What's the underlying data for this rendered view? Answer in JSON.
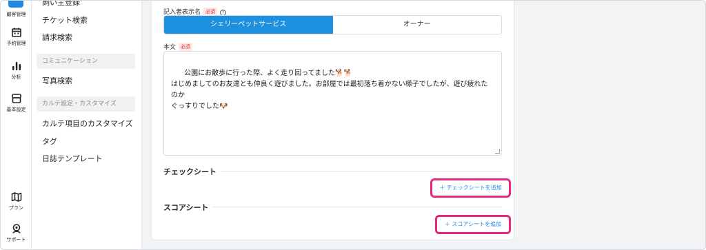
{
  "rail": {
    "items": [
      {
        "label": "顧客管理",
        "icon": "customer-icon"
      },
      {
        "label": "予約管理",
        "icon": "calendar-icon"
      },
      {
        "label": "分析",
        "icon": "chart-icon"
      },
      {
        "label": "基本設定",
        "icon": "settings-box-icon"
      },
      {
        "label": "プラン",
        "icon": "map-icon"
      },
      {
        "label": "サポート",
        "icon": "support-icon"
      }
    ]
  },
  "subnav": {
    "items_top": [
      "飼い主登録",
      "チケット検索",
      "請求検索"
    ],
    "section_communication": "コミュニケーション",
    "items_comm": [
      "写真検索"
    ],
    "section_custom": "カルテ設定・カスタマイズ",
    "items_custom": [
      "カルテ項目のカスタマイズ",
      "タグ",
      "日誌テンプレート"
    ]
  },
  "form": {
    "author_label": "記入者表示名",
    "required": "必須",
    "help": "?",
    "author_options": [
      "シェリーペットサービス",
      "オーナー"
    ],
    "body_label": "本文",
    "body_text": "公園にお散歩に行った際、よく走り回ってました🐕🐕\nはじめましてのお友達とも仲良く遊びました。お部屋では最初落ち着かない様子でしたが、遊び疲れたのか\nぐっすりでした🐶",
    "checksheet_heading": "チェックシート",
    "checksheet_add": "＋ チェックシートを追加",
    "scoresheet_heading": "スコアシート",
    "scoresheet_add": "＋ スコアシートを追加"
  },
  "colors": {
    "accent": "#1e90e0",
    "highlight": "#e8247c",
    "required": "#d32f2f"
  }
}
